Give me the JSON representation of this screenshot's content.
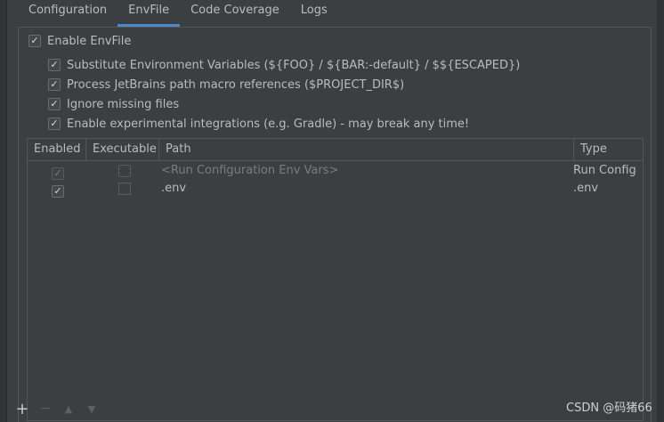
{
  "tabs": [
    {
      "label": "Configuration",
      "active": false
    },
    {
      "label": "EnvFile",
      "active": true
    },
    {
      "label": "Code Coverage",
      "active": false
    },
    {
      "label": "Logs",
      "active": false
    }
  ],
  "options": {
    "enable_envfile": {
      "label": "Enable EnvFile",
      "checked": true
    },
    "substitute": {
      "label": "Substitute Environment Variables (${FOO} / ${BAR:-default} / $${ESCAPED})",
      "checked": true
    },
    "macros": {
      "label": "Process JetBrains path macro references ($PROJECT_DIR$)",
      "checked": true
    },
    "ignore_missing": {
      "label": "Ignore missing files",
      "checked": true
    },
    "experimental": {
      "label": "Enable experimental integrations (e.g. Gradle) - may break any time!",
      "checked": true
    }
  },
  "table": {
    "columns": [
      "Enabled",
      "Executable",
      "Path",
      "Type"
    ],
    "rows": [
      {
        "enabled": true,
        "executable": false,
        "path": "<Run Configuration Env Vars>",
        "type": "Run Config",
        "dimmed": true
      },
      {
        "enabled": true,
        "executable": false,
        "path": ".env",
        "type": ".env",
        "dimmed": false
      }
    ]
  },
  "toolbar": {
    "add": "+",
    "remove": "−",
    "up": "▲",
    "down": "▼"
  },
  "check_glyph": "✓",
  "watermark": "CSDN @码猪66",
  "colors": {
    "accent": "#4a88c7",
    "background": "#3c3f41",
    "text": "#bbbbbb"
  }
}
